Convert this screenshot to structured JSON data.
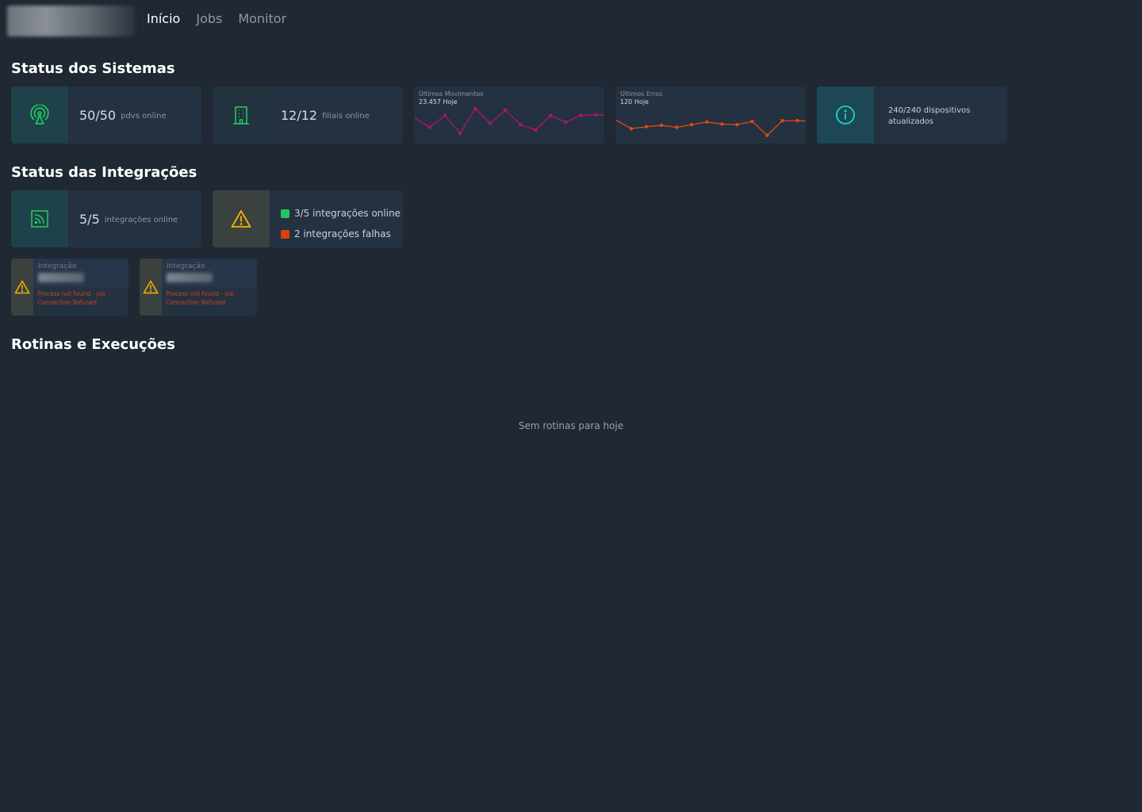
{
  "nav": {
    "items": [
      {
        "label": "Início",
        "active": true
      },
      {
        "label": "Jobs",
        "active": false
      },
      {
        "label": "Monitor",
        "active": false
      }
    ]
  },
  "sections": {
    "sistemas": "Status dos Sistemas",
    "integracoes": "Status das Integrações",
    "rotinas": "Rotinas e Execuções"
  },
  "sistemas": {
    "pdvs": {
      "value": "50/50",
      "label": "pdvs online",
      "icon": "wifi-tower-icon",
      "color": "#22c55e"
    },
    "filiais": {
      "value": "12/12",
      "label": "filiais online",
      "icon": "building-icon",
      "color": "#22c55e"
    },
    "movimentos": {
      "title": "Últimos Movimentos",
      "subtitle": "23.457 Hoje"
    },
    "erros": {
      "title": "Últimos Erros",
      "subtitle": "120 Hoje"
    },
    "dispositivos": {
      "text": "240/240 dispositivos atualizados",
      "icon": "info-icon",
      "color": "#14d9c5"
    }
  },
  "chart_data": [
    {
      "type": "line",
      "title": "Últimos Movimentos",
      "subtitle": "23.457 Hoje",
      "color": "#b0126f",
      "values": [
        36,
        22,
        40,
        13,
        50,
        28,
        48,
        26,
        18,
        40,
        30,
        40,
        41
      ]
    },
    {
      "type": "line",
      "title": "Últimos Erros",
      "subtitle": "120 Hoje",
      "color": "#e04a14",
      "values": [
        33,
        20,
        23,
        25,
        22,
        26,
        30,
        27,
        26,
        31,
        10,
        32,
        32
      ]
    }
  ],
  "integracoes": {
    "online": {
      "value": "5/5",
      "label": "integrações online",
      "icon": "rss-icon",
      "color": "#22c55e"
    },
    "legend": {
      "icon": "warning-icon",
      "items": [
        {
          "label": "3/5 integrações online",
          "color": "#22c55e"
        },
        {
          "label": "2 integrações falhas",
          "color": "#d9410f"
        }
      ]
    },
    "falhas": [
      {
        "label": "Integração",
        "errors": [
          "Process not found - job",
          "Connection Refused"
        ]
      },
      {
        "label": "Integração",
        "errors": [
          "Process not found - job",
          "Connection Refused"
        ]
      }
    ]
  },
  "rotinas": {
    "empty": "Sem rotinas para hoje"
  },
  "colors": {
    "background": "#1f2833",
    "card": "#243140",
    "warning": "#f5b400"
  }
}
